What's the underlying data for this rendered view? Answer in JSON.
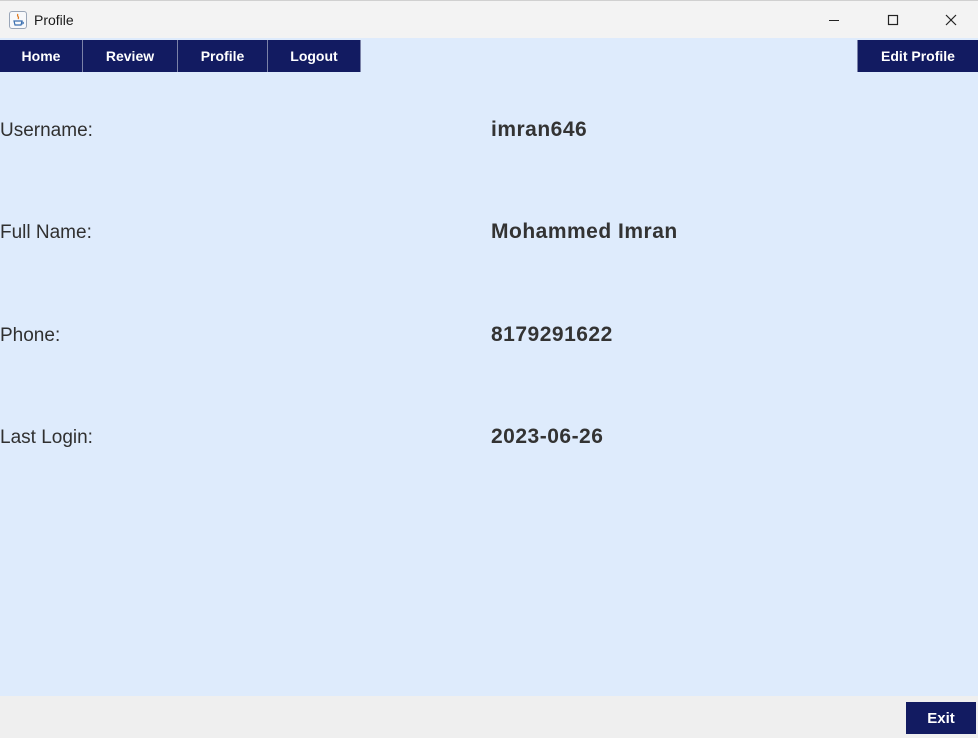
{
  "window": {
    "title": "Profile"
  },
  "nav": {
    "items": [
      {
        "label": "Home"
      },
      {
        "label": "Review"
      },
      {
        "label": "Profile"
      },
      {
        "label": "Logout"
      }
    ],
    "edit_profile": "Edit Profile"
  },
  "profile": {
    "fields": [
      {
        "label": "Username:",
        "value": "imran646"
      },
      {
        "label": "Full Name:",
        "value": "Mohammed Imran"
      },
      {
        "label": "Phone:",
        "value": "8179291622"
      },
      {
        "label": "Last Login:",
        "value": "2023-06-26"
      }
    ]
  },
  "footer": {
    "exit_label": "Exit"
  },
  "colors": {
    "nav_bg": "#121b61",
    "content_bg": "#deebfc",
    "text": "#333333"
  }
}
